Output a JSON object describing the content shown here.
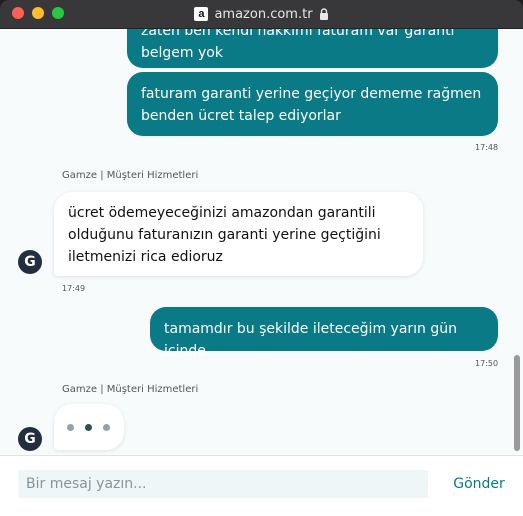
{
  "browser": {
    "url": "amazon.com.tr",
    "favicon_letter": "a"
  },
  "chat": {
    "messages": [
      {
        "from": "user",
        "lines": [
          "zaten ben kendi hakkımı faturam var garanti",
          "belgem yok"
        ]
      },
      {
        "from": "user",
        "lines": [
          "faturam garanti yerine geçiyor dememe rağmen",
          "benden ücret talep ediyorlar"
        ],
        "time": "17:48"
      },
      {
        "from": "agent",
        "sender": "Gamze | Müşteri Hizmetleri",
        "avatar": "G",
        "lines": [
          "ücret ödemeyeceğinizi amazondan garantili",
          "olduğunu faturanızın garanti yerine geçtiğini",
          "iletmenizi rica edioruz"
        ],
        "time": "17:49"
      },
      {
        "from": "user",
        "lines": [
          "tamamdır bu şekilde ileteceğim yarın gün içinde"
        ],
        "time": "17:50"
      }
    ],
    "typing": {
      "sender": "Gamze | Müşteri Hizmetleri",
      "avatar": "G"
    }
  },
  "composer": {
    "placeholder": "Bir mesaj yazın...",
    "send_label": "Gönder"
  },
  "colors": {
    "accent": "#0a7a86",
    "avatar_bg": "#232f3e"
  },
  "icons": {
    "lock": "lock-icon"
  }
}
